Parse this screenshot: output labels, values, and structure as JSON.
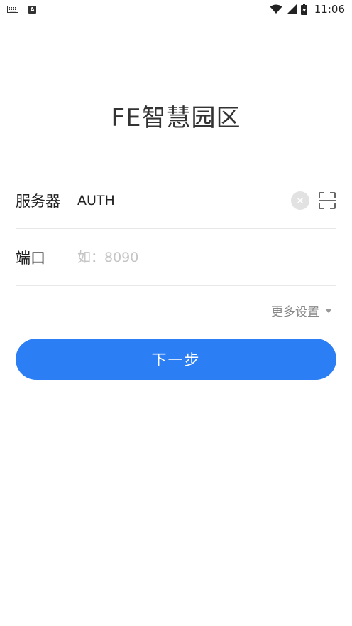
{
  "status_bar": {
    "time": "11:06",
    "left_icons": [
      "keyboard-icon",
      "a-icon"
    ],
    "right_icons": [
      "wifi-icon",
      "cell-signal-icon",
      "battery-icon"
    ],
    "a_letter": "A"
  },
  "app": {
    "title": "FE智慧园区"
  },
  "form": {
    "server": {
      "label": "服务器",
      "value": "AUTH",
      "placeholder": ""
    },
    "port": {
      "label": "端口",
      "value": "",
      "placeholder": "如：8090"
    }
  },
  "more_settings": {
    "label": "更多设置"
  },
  "next_button": {
    "label": "下一步"
  },
  "colors": {
    "primary": "#2b7ef4",
    "placeholder": "#c4c4c4",
    "divider": "#e8e8e8",
    "muted_text": "#888888"
  }
}
